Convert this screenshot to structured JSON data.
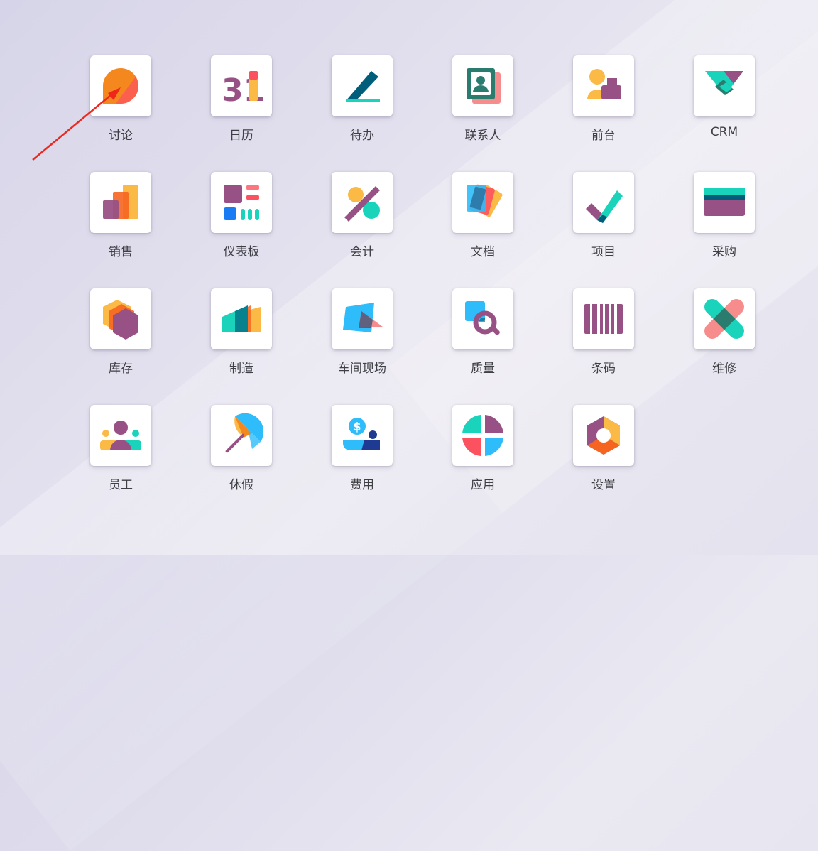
{
  "apps": [
    {
      "id": "discuss",
      "label": "讨论",
      "icon": "discuss-icon"
    },
    {
      "id": "calendar",
      "label": "日历",
      "icon": "calendar-icon",
      "icon_text": "31"
    },
    {
      "id": "todo",
      "label": "待办",
      "icon": "todo-icon"
    },
    {
      "id": "contacts",
      "label": "联系人",
      "icon": "contacts-icon"
    },
    {
      "id": "frontdesk",
      "label": "前台",
      "icon": "frontdesk-icon"
    },
    {
      "id": "crm",
      "label": "CRM",
      "icon": "crm-icon"
    },
    {
      "id": "sales",
      "label": "销售",
      "icon": "sales-icon"
    },
    {
      "id": "dashboards",
      "label": "仪表板",
      "icon": "dashboards-icon"
    },
    {
      "id": "accounting",
      "label": "会计",
      "icon": "accounting-icon"
    },
    {
      "id": "documents",
      "label": "文档",
      "icon": "documents-icon"
    },
    {
      "id": "project",
      "label": "项目",
      "icon": "project-icon"
    },
    {
      "id": "purchase",
      "label": "采购",
      "icon": "purchase-icon"
    },
    {
      "id": "inventory",
      "label": "库存",
      "icon": "inventory-icon"
    },
    {
      "id": "manufacturing",
      "label": "制造",
      "icon": "manufacturing-icon"
    },
    {
      "id": "shopfloor",
      "label": "车间现场",
      "icon": "shopfloor-icon"
    },
    {
      "id": "quality",
      "label": "质量",
      "icon": "quality-icon"
    },
    {
      "id": "barcode",
      "label": "条码",
      "icon": "barcode-icon"
    },
    {
      "id": "maintenance",
      "label": "维修",
      "icon": "maintenance-icon"
    },
    {
      "id": "employees",
      "label": "员工",
      "icon": "employees-icon"
    },
    {
      "id": "timeoff",
      "label": "休假",
      "icon": "timeoff-icon"
    },
    {
      "id": "expenses",
      "label": "费用",
      "icon": "expenses-icon",
      "icon_text": "$"
    },
    {
      "id": "apps",
      "label": "应用",
      "icon": "apps-icon"
    },
    {
      "id": "settings",
      "label": "设置",
      "icon": "settings-icon"
    }
  ],
  "colors": {
    "orange": "#f5871f",
    "purple": "#985184",
    "teal": "#1ad3bb",
    "blue": "#2ebcfa",
    "yellow": "#fbb945",
    "red": "#fc525f",
    "pink": "#f78c8c",
    "darkteal": "#005e7a",
    "navy": "#1f3a93"
  }
}
